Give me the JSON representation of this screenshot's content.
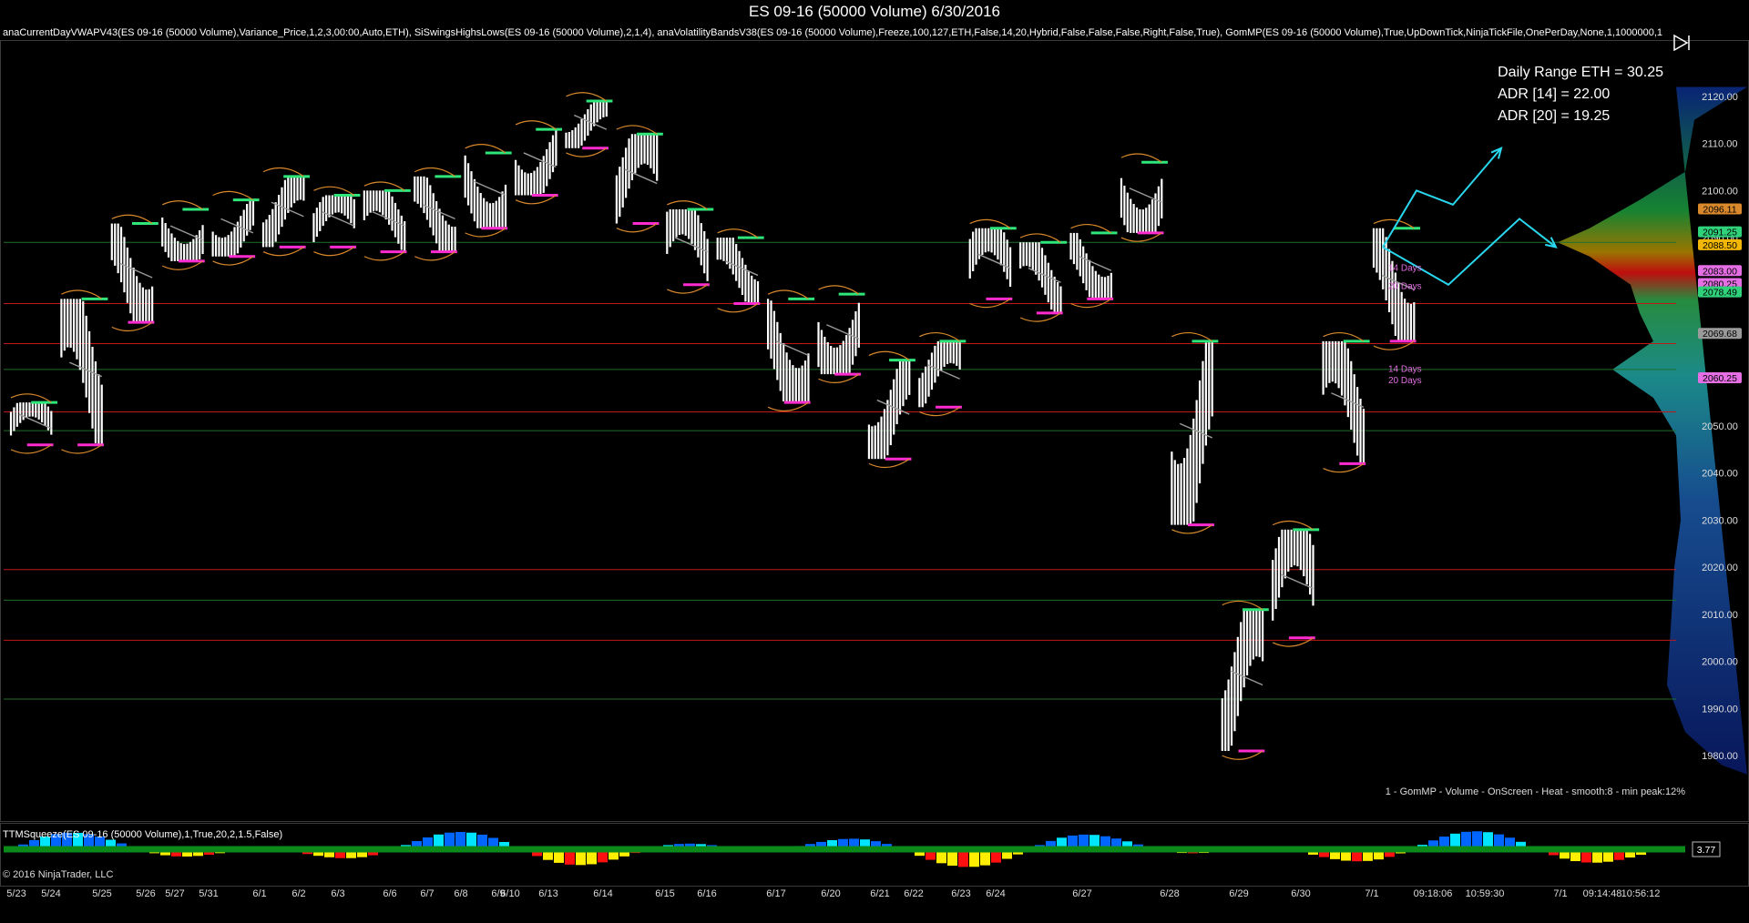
{
  "window": {
    "title": "ES 09-16 (50000 Volume)  6/30/2016",
    "indicators_line": "anaCurrentDayVWAPV43(ES 09-16 (50000 Volume),Variance_Price,1,2,3,00:00,Auto,ETH), SiSwingsHighsLows(ES 09-16 (50000 Volume),2,1,4), anaVolatilityBandsV38(ES 09-16 (50000 Volume),Freeze,100,127,ETH,False,14,20,Hybrid,False,False,False,Right,False,True), GomMP(ES 09-16 (50000 Volume),True,UpDownTick,NinjaTickFile,OnePerDay,None,1,1000000,1",
    "copyright": "© 2016 NinjaTrader, LLC"
  },
  "stats": {
    "daily_range": "Daily Range ETH = 30.25",
    "adr14": "ADR [14] = 22.00",
    "adr20": "ADR [20] = 19.25"
  },
  "profile_label": "1 - GomMP  - Volume - OnScreen - Heat - smooth:8 - min peak:12%",
  "lower_panel": {
    "title": "TTMSqueeze(ES 09-16 (50000 Volume),1,True,20,2,1.5,False)",
    "value_tag": "3.77"
  },
  "labels": {
    "days14_a": "14 Days",
    "days20_a": "20 Days",
    "days14_b": "14 Days",
    "days20_b": "20 Days"
  },
  "price_tags": [
    {
      "text": "2096.11",
      "value": 2096.11,
      "color": "#d9892b"
    },
    {
      "text": "2091.25",
      "value": 2091.25,
      "color": "#2fd17a"
    },
    {
      "text": "2088.50",
      "value": 2088.5,
      "color": "#f2b705"
    },
    {
      "text": "2083.00",
      "value": 2083.0,
      "color": "#e56ee5"
    },
    {
      "text": "2080.25",
      "value": 2080.25,
      "color": "#e56ee5"
    },
    {
      "text": "2078.49",
      "value": 2078.49,
      "color": "#2fd17a"
    },
    {
      "text": "2069.68",
      "value": 2069.68,
      "color": "#9a9a9a"
    },
    {
      "text": "2060.25",
      "value": 2060.25,
      "color": "#e56ee5"
    }
  ],
  "time_axis": [
    "5/23",
    "5/24",
    "5/25",
    "5/26",
    "5/27",
    "5/31",
    "6/1",
    "6/2",
    "6/3",
    "6/6",
    "6/7",
    "6/8",
    "6/9",
    "6/10",
    "6/13",
    "6/14",
    "6/15",
    "6/16",
    "6/17",
    "6/20",
    "6/21",
    "6/22",
    "6/23",
    "6/24",
    "6/27",
    "6/28",
    "6/29",
    "6/30",
    "7/1",
    "09:18:06",
    "10:59:30",
    "7/1",
    "09:14:48",
    "10:56:12"
  ],
  "colors": {
    "background": "#000000",
    "price_bars": "#ffffff",
    "swing_high": "#2ee67a",
    "swing_low": "#ff2bd0",
    "vwap_band": "#d9892b",
    "vwap_mid": "#9a9a9a",
    "projection": "#29d8ef",
    "red_level": "#c11919",
    "green_level": "#1f6e2a"
  },
  "chart_data": {
    "type": "candlestick",
    "symbol": "ES 09-16 (50000 Volume)",
    "ylim": [
      1975,
      2125
    ],
    "y_ticks": [
      1980,
      1990,
      2000,
      2010,
      2020,
      2030,
      2040,
      2050,
      2060,
      2070,
      2080,
      2090,
      2100,
      2110,
      2120
    ],
    "x_ticks": [
      "5/23",
      "5/24",
      "5/25",
      "5/26",
      "5/27",
      "5/31",
      "6/1",
      "6/2",
      "6/3",
      "6/6",
      "6/7",
      "6/8",
      "6/9",
      "6/10",
      "6/13",
      "6/14",
      "6/15",
      "6/16",
      "6/17",
      "6/20",
      "6/21",
      "6/22",
      "6/23",
      "6/24",
      "6/27",
      "6/28",
      "6/29",
      "6/30",
      "7/1",
      "09:18:06",
      "10:59:30",
      "7/1",
      "09:14:48",
      "10:56:12"
    ],
    "horizontal_levels": [
      {
        "price": 2089.0,
        "color": "green"
      },
      {
        "price": 2076.0,
        "color": "red"
      },
      {
        "price": 2067.5,
        "color": "red"
      },
      {
        "price": 2062.0,
        "color": "green"
      },
      {
        "price": 2053.0,
        "color": "red"
      },
      {
        "price": 2049.0,
        "color": "green"
      },
      {
        "price": 2019.5,
        "color": "red"
      },
      {
        "price": 2013.0,
        "color": "green"
      },
      {
        "price": 2004.5,
        "color": "red"
      },
      {
        "price": 1992.0,
        "color": "green"
      }
    ],
    "price_path": [
      {
        "d": "5/23",
        "low": 2046,
        "high": 2055
      },
      {
        "d": "5/24",
        "low": 2046,
        "high": 2077
      },
      {
        "d": "5/25",
        "low": 2072,
        "high": 2093
      },
      {
        "d": "5/26",
        "low": 2085,
        "high": 2096
      },
      {
        "d": "5/27",
        "low": 2086,
        "high": 2098
      },
      {
        "d": "5/31",
        "low": 2088,
        "high": 2103
      },
      {
        "d": "6/1",
        "low": 2088,
        "high": 2099
      },
      {
        "d": "6/2",
        "low": 2087,
        "high": 2100
      },
      {
        "d": "6/3",
        "low": 2087,
        "high": 2103
      },
      {
        "d": "6/6",
        "low": 2092,
        "high": 2108
      },
      {
        "d": "6/7",
        "low": 2099,
        "high": 2113
      },
      {
        "d": "6/8",
        "low": 2109,
        "high": 2119
      },
      {
        "d": "6/9",
        "low": 2093,
        "high": 2112
      },
      {
        "d": "6/10",
        "low": 2080,
        "high": 2096
      },
      {
        "d": "6/13",
        "low": 2076,
        "high": 2090
      },
      {
        "d": "6/14",
        "low": 2055,
        "high": 2077
      },
      {
        "d": "6/15",
        "low": 2061,
        "high": 2078
      },
      {
        "d": "6/16",
        "low": 2043,
        "high": 2064
      },
      {
        "d": "6/17",
        "low": 2054,
        "high": 2068
      },
      {
        "d": "6/20",
        "low": 2077,
        "high": 2092
      },
      {
        "d": "6/21",
        "low": 2074,
        "high": 2089
      },
      {
        "d": "6/22",
        "low": 2077,
        "high": 2091
      },
      {
        "d": "6/23",
        "low": 2091,
        "high": 2106
      },
      {
        "d": "6/24",
        "low": 2029,
        "high": 2068
      },
      {
        "d": "6/27",
        "low": 1981,
        "high": 2011
      },
      {
        "d": "6/28",
        "low": 2005,
        "high": 2028
      },
      {
        "d": "6/29",
        "low": 2042,
        "high": 2068
      },
      {
        "d": "6/30",
        "low": 2068,
        "high": 2092
      }
    ],
    "last_price": 2088.5,
    "ttm_squeeze_value": 3.77
  }
}
